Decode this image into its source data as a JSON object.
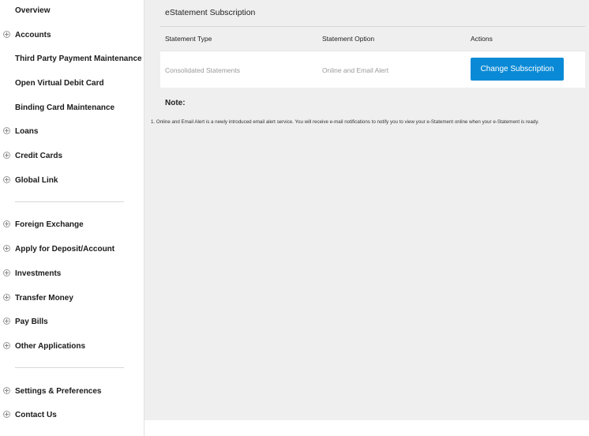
{
  "sidebar": {
    "items": [
      {
        "label": "Overview",
        "icon": ""
      },
      {
        "label": "Accounts",
        "icon": "plus-circle-icon"
      },
      {
        "label": "Third Party Payment Maintenance",
        "icon": ""
      },
      {
        "label": "Open Virtual Debit Card",
        "icon": ""
      },
      {
        "label": "Binding Card Maintenance",
        "icon": ""
      },
      {
        "label": "Loans",
        "icon": "plus-circle-icon"
      },
      {
        "label": "Credit Cards",
        "icon": "plus-circle-icon"
      },
      {
        "label": "Global Link",
        "icon": "plus-circle-icon"
      },
      {
        "label": "Foreign Exchange",
        "icon": "plus-circle-icon"
      },
      {
        "label": "Apply for Deposit/Account",
        "icon": "plus-circle-icon"
      },
      {
        "label": "Investments",
        "icon": "plus-circle-icon"
      },
      {
        "label": "Transfer Money",
        "icon": "plus-circle-icon"
      },
      {
        "label": "Pay Bills",
        "icon": "plus-circle-icon"
      },
      {
        "label": "Other Applications",
        "icon": "plus-circle-icon"
      },
      {
        "label": "Settings & Preferences",
        "icon": "plus-circle-icon"
      },
      {
        "label": "Contact Us",
        "icon": "plus-circle-icon"
      }
    ]
  },
  "main": {
    "title": "eStatement Subscription",
    "table": {
      "headers": [
        "Statement Type",
        "Statement Option",
        "Actions"
      ],
      "rows": [
        {
          "type": "Consolidated Statements",
          "option": "Online and Email Alert",
          "action": "Change Subscription"
        }
      ]
    },
    "note": {
      "title": "Note:",
      "items": [
        "1. Online and Email Alert is a newly introduced email alert service. You will receive e-mail notifications to notify you to view your e-Statement online when your e-Statement is ready."
      ]
    }
  },
  "colors": {
    "accent": "#0a8ad6",
    "content_bg": "#efefef"
  }
}
